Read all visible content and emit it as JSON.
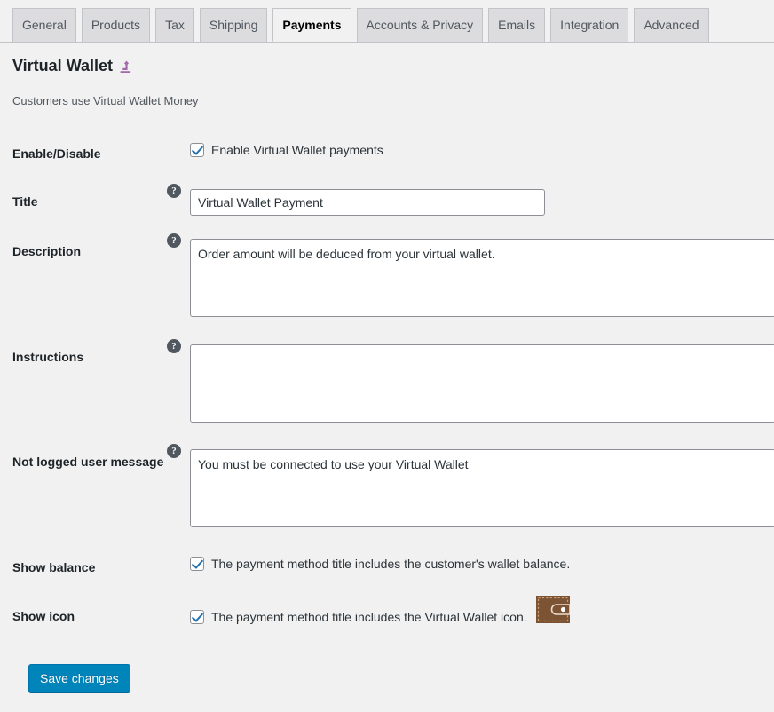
{
  "tabs": [
    {
      "label": "General",
      "active": false
    },
    {
      "label": "Products",
      "active": false
    },
    {
      "label": "Tax",
      "active": false
    },
    {
      "label": "Shipping",
      "active": false
    },
    {
      "label": "Payments",
      "active": true
    },
    {
      "label": "Accounts & Privacy",
      "active": false
    },
    {
      "label": "Emails",
      "active": false
    },
    {
      "label": "Integration",
      "active": false
    },
    {
      "label": "Advanced",
      "active": false
    }
  ],
  "section": {
    "title": "Virtual Wallet",
    "back_icon": "return-arrow-icon",
    "description": "Customers use Virtual Wallet Money"
  },
  "fields": {
    "enable": {
      "label": "Enable/Disable",
      "checkbox_label": "Enable Virtual Wallet payments",
      "checked": true
    },
    "title": {
      "label": "Title",
      "help": "?",
      "value": "Virtual Wallet Payment",
      "placeholder": ""
    },
    "description": {
      "label": "Description",
      "help": "?",
      "value": "Order amount will be deduced from your virtual wallet.",
      "placeholder": ""
    },
    "instructions": {
      "label": "Instructions",
      "help": "?",
      "value": "",
      "placeholder": ""
    },
    "not_logged_message": {
      "label": "Not logged user message",
      "help": "?",
      "value": "You must be connected to use your Virtual Wallet",
      "placeholder": ""
    },
    "show_balance": {
      "label": "Show balance",
      "checkbox_label": "The payment method title includes the customer's wallet balance.",
      "checked": true
    },
    "show_icon": {
      "label": "Show icon",
      "checkbox_label": "The payment method title includes the Virtual Wallet icon.",
      "checked": true,
      "icon_name": "wallet-icon"
    }
  },
  "submit": {
    "label": "Save changes"
  },
  "colors": {
    "page_background": "#f1f1f1",
    "tab_inactive": "#dcdcde",
    "tab_border": "#c3c4c7",
    "primary_button": "#0085ba",
    "checkbox_check": "#2271b1",
    "help_tip": "#50575e",
    "back_arrow": "#a26ba8",
    "wallet_brown": "#7d5433",
    "wallet_border": "#c8a27a"
  }
}
